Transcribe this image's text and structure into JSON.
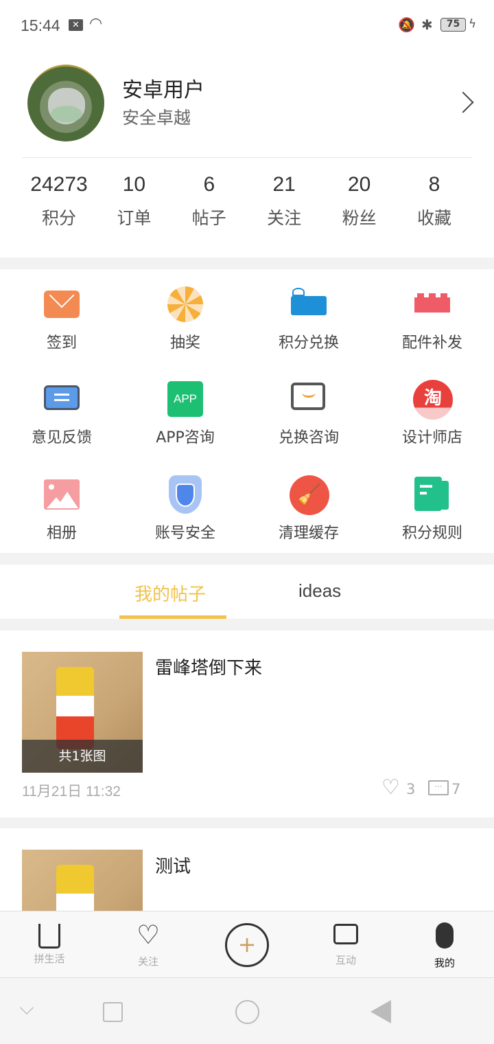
{
  "status_bar": {
    "time": "15:44",
    "battery": "75"
  },
  "profile": {
    "name": "安卓用户",
    "subtitle": "安全卓越"
  },
  "stats": [
    {
      "value": "24273",
      "label": "积分"
    },
    {
      "value": "10",
      "label": "订单"
    },
    {
      "value": "6",
      "label": "帖子"
    },
    {
      "value": "21",
      "label": "关注"
    },
    {
      "value": "20",
      "label": "粉丝"
    },
    {
      "value": "8",
      "label": "收藏"
    }
  ],
  "grid": [
    {
      "label": "签到",
      "icon": "envelope-icon",
      "color": "#f28a52"
    },
    {
      "label": "抽奖",
      "icon": "lottery-wheel-icon",
      "color": "#f6b03a"
    },
    {
      "label": "积分兑换",
      "icon": "gift-icon",
      "color": "#1e90d8"
    },
    {
      "label": "配件补发",
      "icon": "brick-icon",
      "color": "#ef5b67"
    },
    {
      "label": "意见反馈",
      "icon": "feedback-icon",
      "color": "#5b9be8"
    },
    {
      "label": "APP咨询",
      "icon": "app-icon",
      "color": "#1dbf73",
      "text": "APP"
    },
    {
      "label": "兑换咨询",
      "icon": "chat-smile-icon",
      "color": "#555555"
    },
    {
      "label": "设计师店",
      "icon": "taobao-icon",
      "color": "#e8403c",
      "text": "淘"
    },
    {
      "label": "相册",
      "icon": "photo-icon",
      "color": "#f59da0"
    },
    {
      "label": "账号安全",
      "icon": "shield-icon",
      "color": "#4f86ea"
    },
    {
      "label": "清理缓存",
      "icon": "broom-icon",
      "color": "#ee5545"
    },
    {
      "label": "积分规则",
      "icon": "rules-book-icon",
      "color": "#22c08a"
    }
  ],
  "tabs": [
    {
      "label": "我的帖子",
      "active": true
    },
    {
      "label": "ideas",
      "active": false
    }
  ],
  "accent": "#f2c24a",
  "posts": [
    {
      "title": "雷峰塔倒下来",
      "image_count": "共1张图",
      "date": "11月21日 11:32",
      "likes": "3",
      "comments": "7"
    },
    {
      "title": "测试"
    }
  ],
  "bottom_nav": [
    {
      "label": "拼生活"
    },
    {
      "label": "关注"
    },
    {
      "label": ""
    },
    {
      "label": "互动"
    },
    {
      "label": "我的",
      "active": true
    }
  ]
}
